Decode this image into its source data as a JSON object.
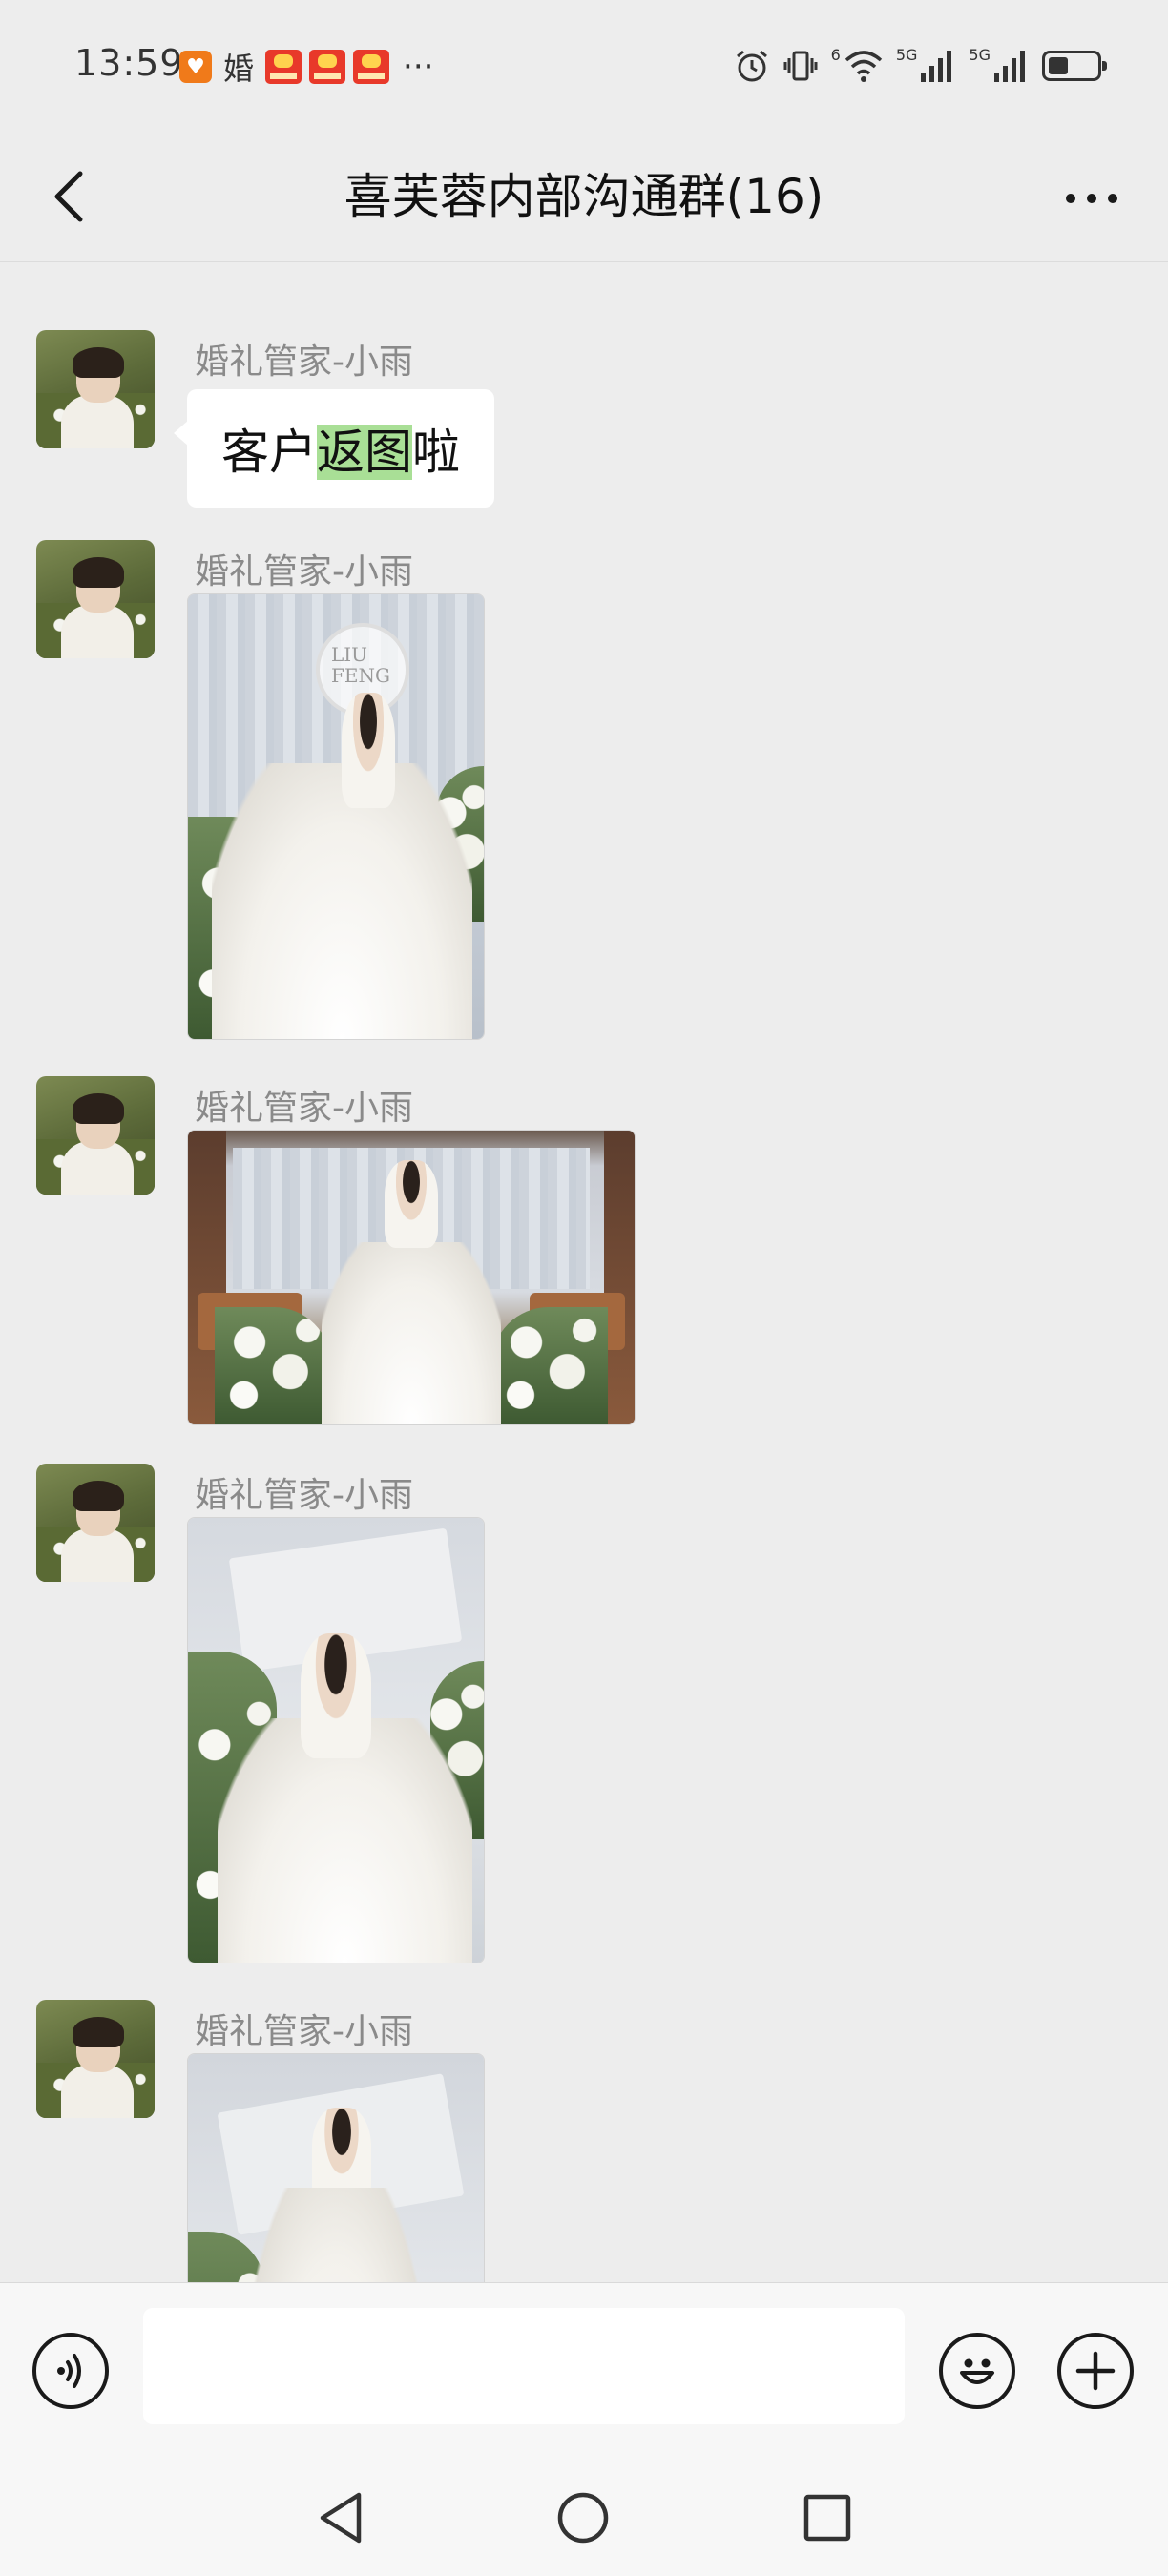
{
  "status_bar": {
    "time": "13:59",
    "notif_text": "婚",
    "more": "···",
    "network_label_1": "6",
    "network_label_2": "5G",
    "network_label_3": "5G",
    "battery_level": 0.4
  },
  "header": {
    "title": "喜芙蓉内部沟通群(16)"
  },
  "messages": [
    {
      "sender": "婚礼管家-小雨",
      "text_before": "客户",
      "text_highlight": "返图",
      "text_after": "啦"
    },
    {
      "sender": "婚礼管家-小雨",
      "type": "image"
    },
    {
      "sender": "婚礼管家-小雨",
      "type": "image"
    },
    {
      "sender": "婚礼管家-小雨",
      "type": "image"
    },
    {
      "sender": "婚礼管家-小雨",
      "type": "image"
    }
  ],
  "photo_text": {
    "sign_line1": "LIU",
    "sign_line2": "FENG"
  },
  "input": {
    "value": "",
    "placeholder": ""
  },
  "icons": {
    "back": "chevron-left-icon",
    "more": "more-dots-icon",
    "voice": "voice-icon",
    "emoji": "emoji-icon",
    "add": "plus-icon",
    "nav_back": "nav-back-icon",
    "nav_home": "nav-home-icon",
    "nav_recents": "nav-recents-icon"
  },
  "colors": {
    "background": "#ededed",
    "bubble": "#ffffff",
    "highlight": "#a9df96",
    "sender": "#8a8a8a"
  }
}
